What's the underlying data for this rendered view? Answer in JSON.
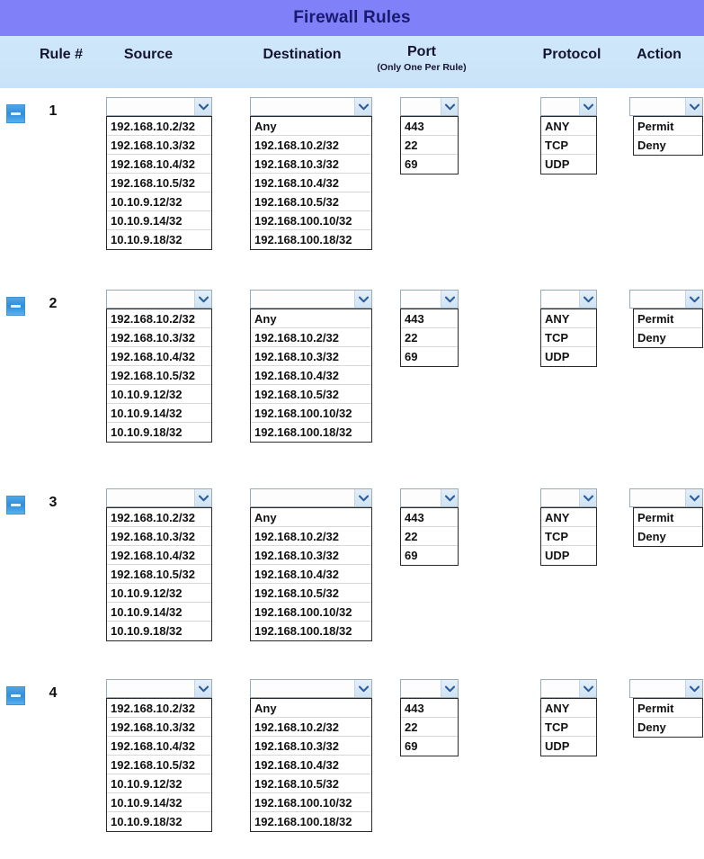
{
  "title": "Firewall Rules",
  "columns": {
    "rule": "Rule #",
    "source": "Source",
    "destination": "Destination",
    "port": "Port",
    "port_sub": "(Only One Per Rule)",
    "protocol": "Protocol",
    "action": "Action"
  },
  "colors": {
    "title_band": "#8080f8",
    "header_band": "#cfe6fa",
    "expander_icon": "#2f8ddc",
    "page_background": "#ffffff"
  },
  "icons": {
    "expander": "minus-collapse-icon",
    "dropdown_arrow": "chevron-down-icon"
  },
  "options": {
    "source": [
      "192.168.10.2/32",
      "192.168.10.3/32",
      "192.168.10.4/32",
      "192.168.10.5/32",
      "10.10.9.12/32",
      "10.10.9.14/32",
      "10.10.9.18/32"
    ],
    "destination": [
      "Any",
      "192.168.10.2/32",
      "192.168.10.3/32",
      "192.168.10.4/32",
      "192.168.10.5/32",
      "192.168.100.10/32",
      "192.168.100.18/32"
    ],
    "port": [
      "443",
      "22",
      "69"
    ],
    "protocol": [
      "ANY",
      "TCP",
      "UDP"
    ],
    "action": [
      "Permit",
      "Deny"
    ]
  },
  "rules": [
    {
      "number": "1",
      "source_value": "",
      "destination_value": "",
      "port_value": "",
      "protocol_value": "",
      "action_value": ""
    },
    {
      "number": "2",
      "source_value": "",
      "destination_value": "",
      "port_value": "",
      "protocol_value": "",
      "action_value": ""
    },
    {
      "number": "3",
      "source_value": "",
      "destination_value": "",
      "port_value": "",
      "protocol_value": "",
      "action_value": ""
    },
    {
      "number": "4",
      "source_value": "",
      "destination_value": "",
      "port_value": "",
      "protocol_value": "",
      "action_value": ""
    }
  ],
  "layout": {
    "row_tops": [
      108,
      322,
      543,
      755
    ]
  }
}
